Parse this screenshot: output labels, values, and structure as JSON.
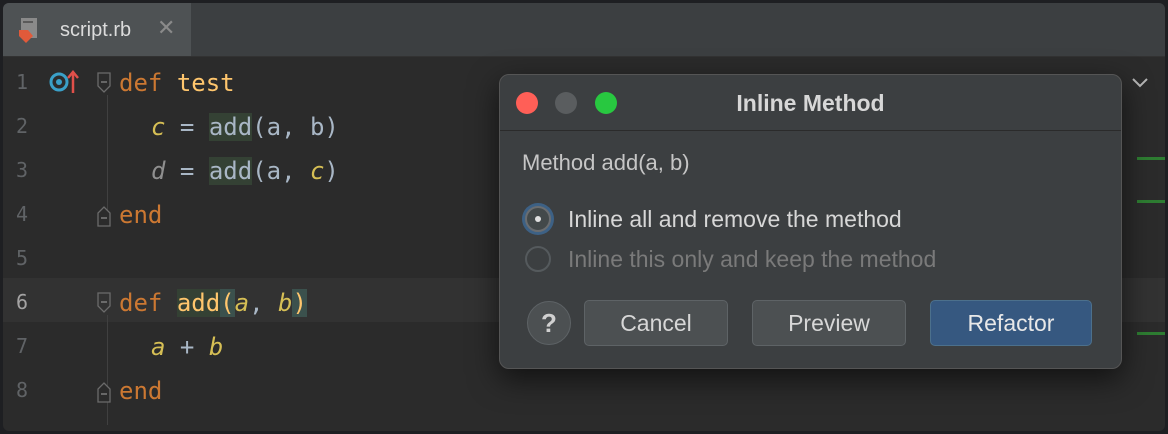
{
  "tab": {
    "filename": "script.rb",
    "close_glyph": "✕",
    "icon": "ruby-file-icon"
  },
  "gutter": {
    "line_numbers": [
      "1",
      "2",
      "3",
      "4",
      "5",
      "6",
      "7",
      "8"
    ],
    "active_line": "6"
  },
  "code": {
    "l1": {
      "kw": "def",
      "name": "test"
    },
    "l2": {
      "var": "c",
      "eq": " = ",
      "call": "add",
      "args_open": "(a, b)"
    },
    "l3": {
      "var": "d",
      "eq": " = ",
      "call": "add",
      "a_open": "(a, ",
      "arg": "c",
      "close": ")"
    },
    "l4": {
      "kw": "end"
    },
    "l6": {
      "kw": "def",
      "name": "add",
      "open": "(",
      "p1": "a",
      "comma": ", ",
      "p2": "b",
      "close": ")"
    },
    "l7": {
      "a": "a",
      "op": " + ",
      "b": "b"
    },
    "l8": {
      "kw": "end"
    }
  },
  "dialog": {
    "title": "Inline Method",
    "subtitle": "Method add(a, b)",
    "option_all": "Inline all and remove the method",
    "option_this": "Inline this only and keep the method",
    "help": "?",
    "cancel": "Cancel",
    "preview": "Preview",
    "refactor": "Refactor"
  },
  "colors": {
    "accent": "#365880",
    "keyword": "#cc7832",
    "method": "#ffc66d"
  }
}
